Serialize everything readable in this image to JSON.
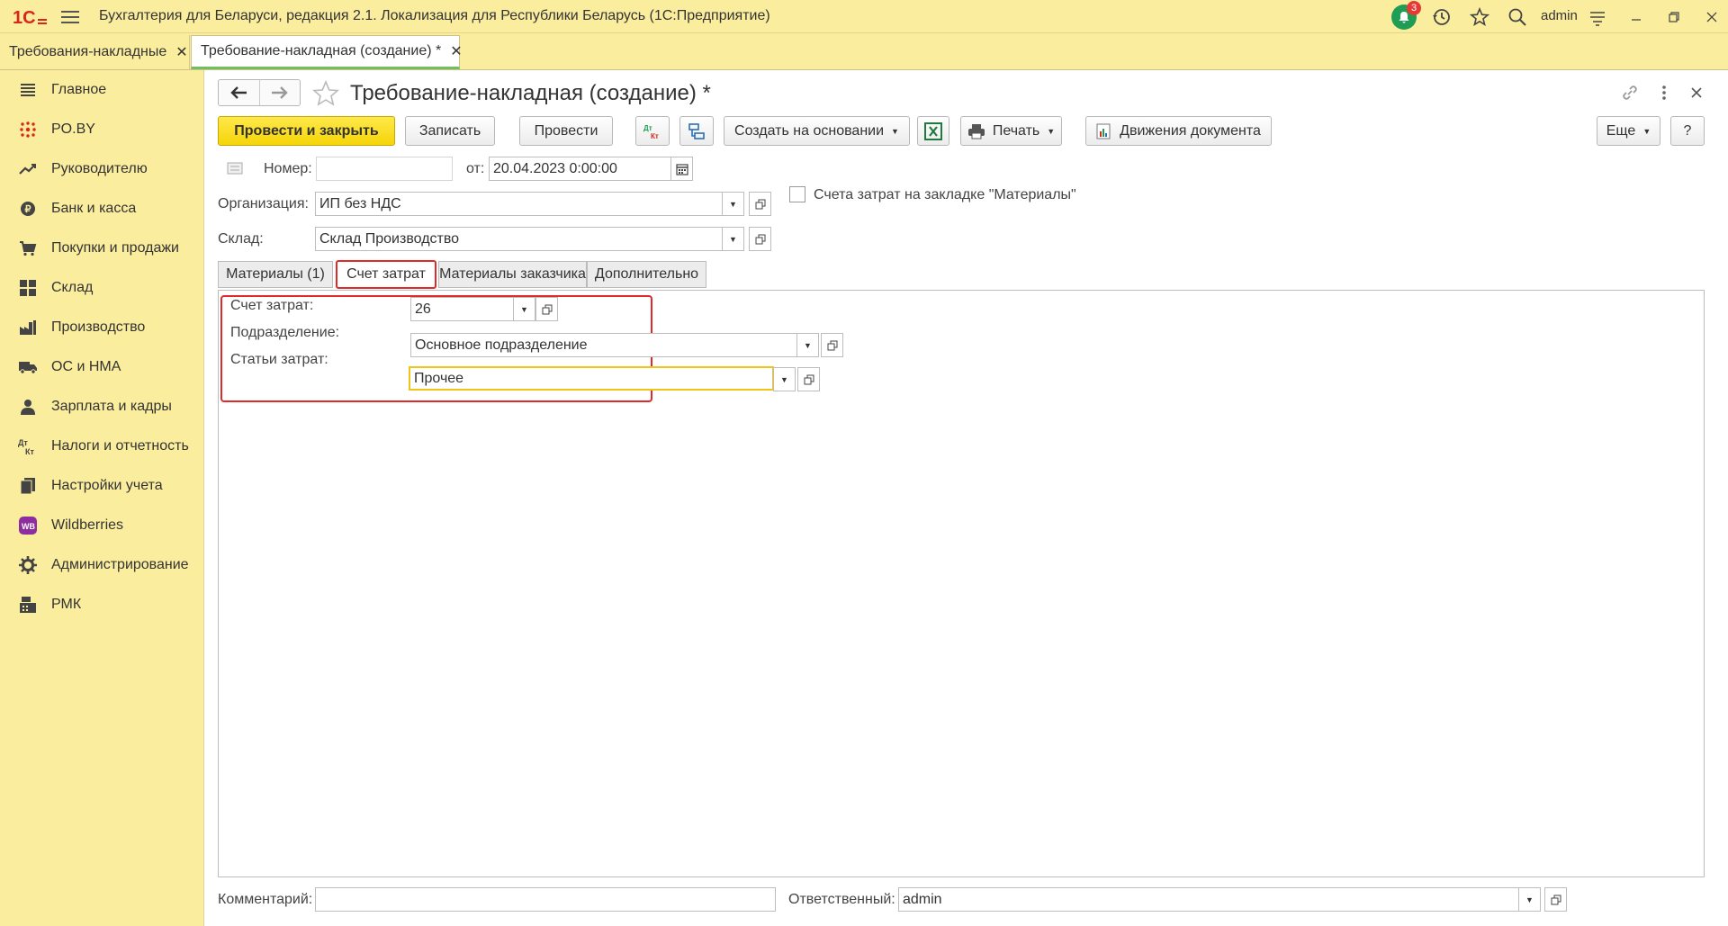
{
  "app": {
    "title": "Бухгалтерия для Беларуси, редакция 2.1. Локализация для Республики Беларусь   (1С:Предприятие)",
    "notifications_count": "3",
    "user": "admin",
    "brand_color": "#fbed9e"
  },
  "open_tabs": [
    {
      "label": "Требования-накладные",
      "close": "✕"
    },
    {
      "label": "Требование-накладная (создание) *",
      "close": "✕"
    }
  ],
  "sidebar": {
    "items": [
      {
        "label": "Главное",
        "icon": "menu-lines-icon"
      },
      {
        "label": "PO.BY",
        "icon": "dots-icon"
      },
      {
        "label": "Руководителю",
        "icon": "trend-icon"
      },
      {
        "label": "Банк и касса",
        "icon": "coin-icon"
      },
      {
        "label": "Покупки и продажи",
        "icon": "cart-icon"
      },
      {
        "label": "Склад",
        "icon": "grid-icon"
      },
      {
        "label": "Производство",
        "icon": "factory-icon"
      },
      {
        "label": "ОС и НМА",
        "icon": "truck-icon"
      },
      {
        "label": "Зарплата и кадры",
        "icon": "person-icon"
      },
      {
        "label": "Налоги и отчетность",
        "icon": "dt-kt-icon"
      },
      {
        "label": "Настройки учета",
        "icon": "books-icon"
      },
      {
        "label": "Wildberries",
        "icon": "wb-icon"
      },
      {
        "label": "Администрирование",
        "icon": "gear-icon"
      },
      {
        "label": "РМК",
        "icon": "cash-register-icon"
      }
    ]
  },
  "form": {
    "title": "Требование-накладная (создание) *",
    "toolbar": {
      "post_close": "Провести и закрыть",
      "save": "Записать",
      "post": "Провести",
      "create_based": "Создать на основании",
      "print": "Печать",
      "movements": "Движения документа",
      "more": "Еще",
      "help": "?"
    },
    "number_label": "Номер:",
    "number_value": "",
    "date_label": "от:",
    "date_value": "20.04.2023  0:00:00",
    "org_label": "Организация:",
    "org_value": "ИП без НДС",
    "warehouse_label": "Склад:",
    "warehouse_value": "Склад Производство",
    "checkbox_label": "Счета затрат на закладке \"Материалы\"",
    "tabs": [
      {
        "label": "Материалы (1)"
      },
      {
        "label": "Счет затрат"
      },
      {
        "label": "Материалы заказчика"
      },
      {
        "label": "Дополнительно"
      }
    ],
    "cost": {
      "account_label": "Счет затрат:",
      "account_value": "26",
      "department_label": "Подразделение:",
      "department_value": "Основное подразделение",
      "items_label": "Статьи затрат:",
      "items_value": "Прочее"
    },
    "comment_label": "Комментарий:",
    "comment_value": "",
    "responsible_label": "Ответственный:",
    "responsible_value": "admin"
  }
}
